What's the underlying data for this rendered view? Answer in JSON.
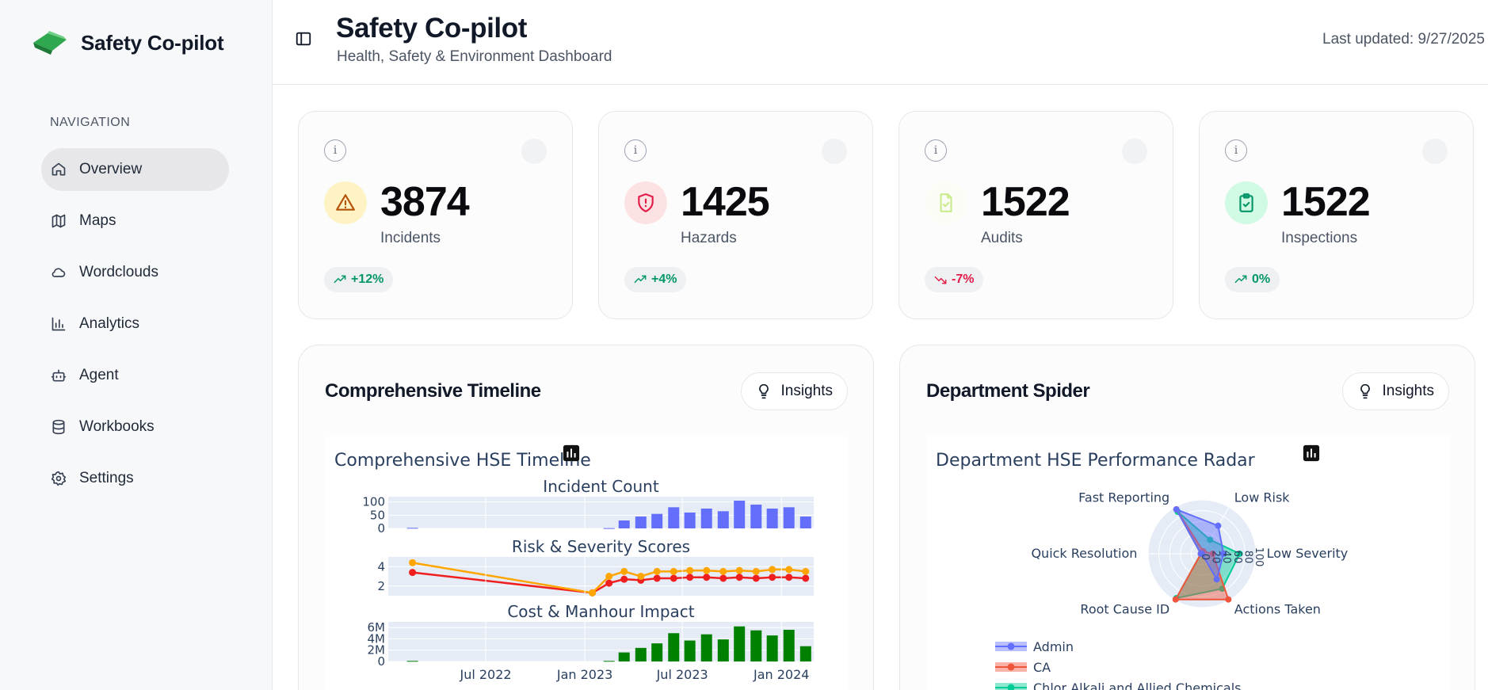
{
  "brand": {
    "name": "Safety Co-pilot",
    "logo_icon": "leaf-logo-icon"
  },
  "navigation": {
    "heading": "NAVIGATION",
    "items": [
      {
        "label": "Overview",
        "icon": "home-icon",
        "active": true
      },
      {
        "label": "Maps",
        "icon": "map-icon",
        "active": false
      },
      {
        "label": "Wordclouds",
        "icon": "cloud-icon",
        "active": false
      },
      {
        "label": "Analytics",
        "icon": "bar-chart-icon",
        "active": false
      },
      {
        "label": "Agent",
        "icon": "bot-icon",
        "active": false
      },
      {
        "label": "Workbooks",
        "icon": "database-icon",
        "active": false
      },
      {
        "label": "Settings",
        "icon": "gear-icon",
        "active": false
      }
    ]
  },
  "header": {
    "title": "Safety Co-pilot",
    "subtitle": "Health, Safety & Environment Dashboard",
    "last_updated": "Last updated: 9/27/2025"
  },
  "stats": [
    {
      "value": "3874",
      "label": "Incidents",
      "trend": "+12%",
      "direction": "up",
      "icon": "warning-triangle-icon",
      "icon_bg": "#fdf3c4",
      "icon_color": "#b45309"
    },
    {
      "value": "1425",
      "label": "Hazards",
      "trend": "+4%",
      "direction": "up",
      "icon": "shield-alert-icon",
      "icon_bg": "#fde2e4",
      "icon_color": "#e11d48"
    },
    {
      "value": "1522",
      "label": "Audits",
      "trend": "-7%",
      "direction": "down",
      "icon": "file-check-icon",
      "icon_bg": "#fbfcf6",
      "icon_color": "#d9f99d"
    },
    {
      "value": "1522",
      "label": "Inspections",
      "trend": "0%",
      "direction": "up",
      "icon": "clipboard-check-icon",
      "icon_bg": "#d1fae5",
      "icon_color": "#059669"
    }
  ],
  "cards": {
    "timeline": {
      "title": "Comprehensive Timeline",
      "insights_label": "Insights"
    },
    "spider": {
      "title": "Department Spider",
      "insights_label": "Insights"
    }
  },
  "chart_data": [
    {
      "type": "bar",
      "title": "Comprehensive HSE Timeline",
      "panels": [
        {
          "subtitle": "Incident Count",
          "type": "bar",
          "x": [
            "2022-02",
            "2023-02",
            "2023-03",
            "2023-04",
            "2023-05",
            "2023-06",
            "2023-07",
            "2023-08",
            "2023-09",
            "2023-10",
            "2023-11",
            "2023-12",
            "2024-01",
            "2024-02"
          ],
          "values": [
            2,
            1,
            30,
            45,
            55,
            80,
            60,
            75,
            65,
            105,
            90,
            75,
            80,
            45
          ],
          "yticks": [
            "0",
            "50",
            "100"
          ],
          "color": "#636efa"
        },
        {
          "subtitle": "Risk & Severity Scores",
          "type": "line",
          "x": [
            "2022-02",
            "2023-01",
            "2023-02",
            "2023-03",
            "2023-04",
            "2023-05",
            "2023-06",
            "2023-07",
            "2023-08",
            "2023-09",
            "2023-10",
            "2023-11",
            "2023-12",
            "2024-01",
            "2024-02"
          ],
          "series": [
            {
              "values": [
                3.4,
                1.3,
                2.3,
                2.7,
                2.6,
                2.8,
                2.8,
                2.9,
                2.9,
                2.8,
                2.9,
                2.8,
                2.9,
                2.9,
                2.8
              ],
              "color": "#ef1f1f"
            },
            {
              "values": [
                4.4,
                1.3,
                3.0,
                3.5,
                3.0,
                3.5,
                3.5,
                3.6,
                3.6,
                3.5,
                3.6,
                3.5,
                3.7,
                3.7,
                3.5
              ],
              "color": "#ffa500"
            }
          ],
          "yticks": [
            "2",
            "4"
          ]
        },
        {
          "subtitle": "Cost & Manhour Impact",
          "type": "bar",
          "x": [
            "2022-02",
            "2023-02",
            "2023-03",
            "2023-04",
            "2023-05",
            "2023-06",
            "2023-07",
            "2023-08",
            "2023-09",
            "2023-10",
            "2023-11",
            "2023-12",
            "2024-01",
            "2024-02"
          ],
          "values": [
            0.1,
            0.1,
            1.6,
            2.4,
            3.2,
            5.0,
            3.7,
            4.8,
            3.9,
            6.2,
            5.5,
            4.6,
            5.6,
            2.7
          ],
          "yticks": [
            "0",
            "2M",
            "4M",
            "6M"
          ],
          "color": "#008000"
        }
      ],
      "x_ticks": [
        "Jul 2022",
        "Jan 2023",
        "Jul 2023",
        "Jan 2024"
      ]
    },
    {
      "type": "radar",
      "title": "Department HSE Performance Radar",
      "axes": [
        "Low Risk",
        "Low Severity",
        "Actions Taken",
        "Root Cause ID",
        "Quick Resolution",
        "Fast Reporting"
      ],
      "radial_ticks": [
        "0",
        "20",
        "40",
        "60",
        "80",
        "100"
      ],
      "series": [
        {
          "name": "Admin",
          "values": [
            60,
            40,
            55,
            0,
            2,
            95
          ],
          "color": "#636efa"
        },
        {
          "name": "CA",
          "values": [
            5,
            20,
            98,
            98,
            2,
            95
          ],
          "color": "#ef553b"
        },
        {
          "name": "Chlor Alkali and Allied Chemicals",
          "values": [
            30,
            70,
            75,
            95,
            2,
            90
          ],
          "color": "#00cc96"
        }
      ]
    }
  ]
}
